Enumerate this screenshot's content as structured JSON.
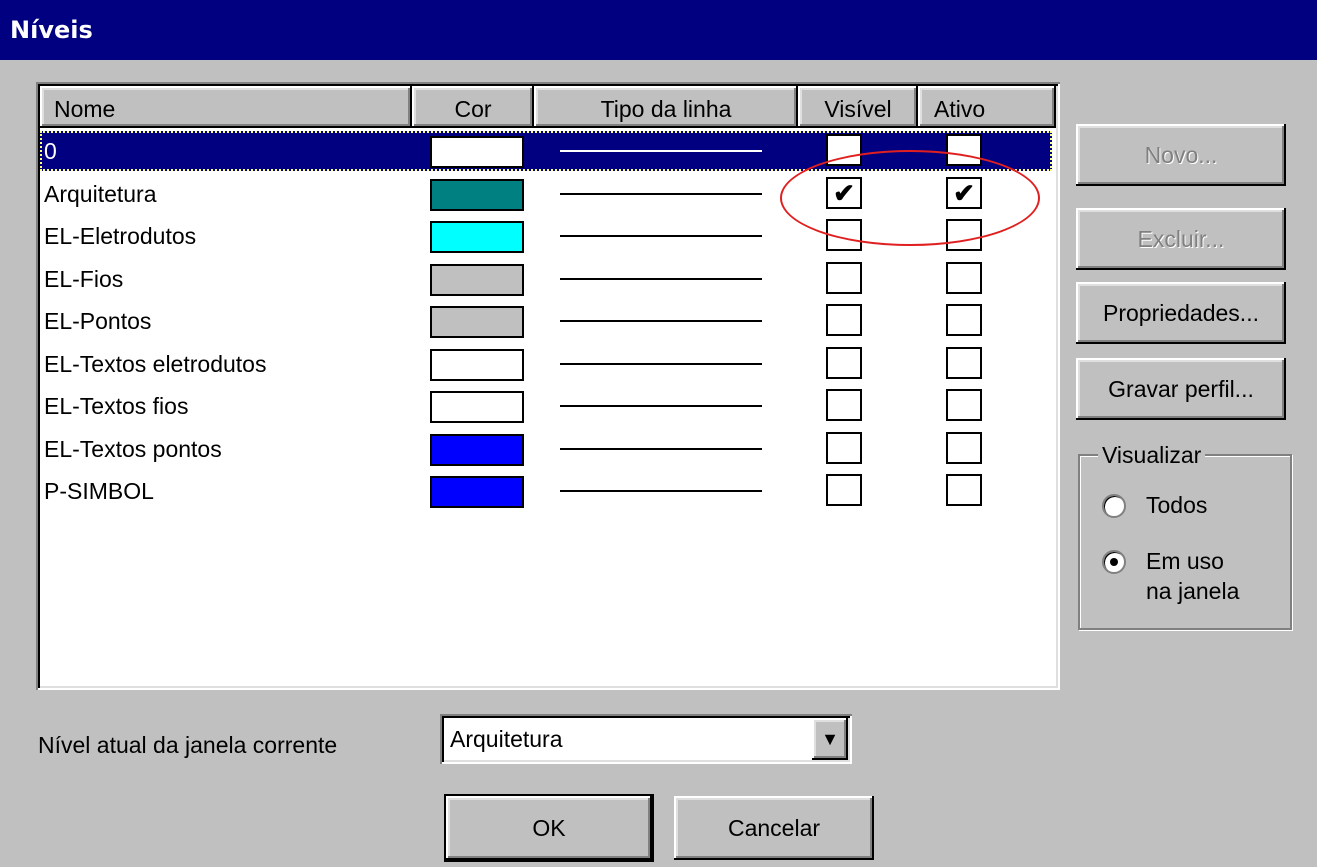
{
  "window": {
    "title": "Níveis"
  },
  "list": {
    "columns": {
      "name": "Nome",
      "color": "Cor",
      "line_type": "Tipo da linha",
      "visible": "Visível",
      "active": "Ativo"
    },
    "rows": [
      {
        "name": "0",
        "color": "#ffffff",
        "visible": false,
        "active": false,
        "selected": true
      },
      {
        "name": "Arquitetura",
        "color": "#008080",
        "visible": true,
        "active": true,
        "selected": false
      },
      {
        "name": "EL-Eletrodutos",
        "color": "#00ffff",
        "visible": false,
        "active": false,
        "selected": false
      },
      {
        "name": "EL-Fios",
        "color": "#c0c0c0",
        "visible": false,
        "active": false,
        "selected": false
      },
      {
        "name": "EL-Pontos",
        "color": "#c0c0c0",
        "visible": false,
        "active": false,
        "selected": false
      },
      {
        "name": "EL-Textos eletrodutos",
        "color": "#ffffff",
        "visible": false,
        "active": false,
        "selected": false
      },
      {
        "name": "EL-Textos fios",
        "color": "#ffffff",
        "visible": false,
        "active": false,
        "selected": false
      },
      {
        "name": "EL-Textos pontos",
        "color": "#0000ff",
        "visible": false,
        "active": false,
        "selected": false
      },
      {
        "name": "P-SIMBOL",
        "color": "#0000ff",
        "visible": false,
        "active": false,
        "selected": false
      }
    ]
  },
  "buttons": {
    "new": "Novo...",
    "delete": "Excluir...",
    "properties": "Propriedades...",
    "save_profile": "Gravar perfil...",
    "ok": "OK",
    "cancel": "Cancelar"
  },
  "view_group": {
    "label": "Visualizar",
    "option_all": "Todos",
    "option_in_use_line1": "Em uso",
    "option_in_use_line2": "na janela",
    "selected": "in_use"
  },
  "current_level": {
    "label": "Nível atual da janela corrente",
    "value": "Arquitetura"
  },
  "colors": {
    "titlebar": "#000080",
    "face": "#c0c0c0",
    "annotation": "#e02020"
  }
}
